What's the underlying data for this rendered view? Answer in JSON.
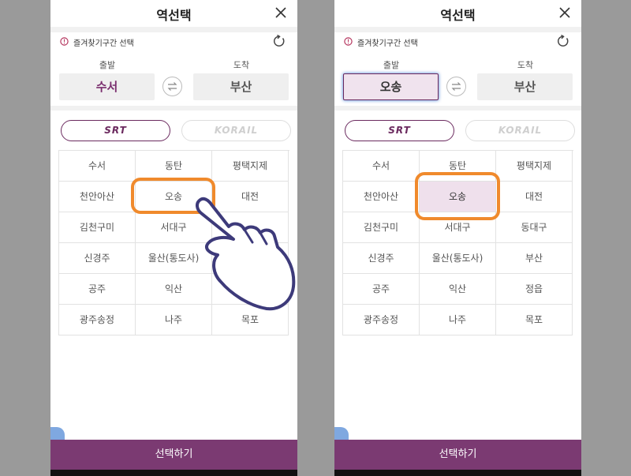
{
  "title": "역선택",
  "favorites_label": "즐겨찾기구간 선택",
  "direction": {
    "departure_label": "출발",
    "arrival_label": "도착"
  },
  "left": {
    "departure": "수서",
    "arrival": "부산"
  },
  "right": {
    "departure": "오송",
    "arrival": "부산"
  },
  "companies": {
    "srt": "SRT",
    "korail": "KORAIL"
  },
  "left_stations": [
    "수서",
    "동탄",
    "평택지제",
    "천안아산",
    "오송",
    "대전",
    "김천구미",
    "서대구",
    "",
    "신경주",
    "울산(통도사)",
    "",
    "공주",
    "익산",
    "",
    "광주송정",
    "나주",
    "목포"
  ],
  "right_stations": [
    "수서",
    "동탄",
    "평택지제",
    "천안아산",
    "오송",
    "대전",
    "김천구미",
    "서대구",
    "동대구",
    "신경주",
    "울산(통도사)",
    "부산",
    "공주",
    "익산",
    "정읍",
    "광주송정",
    "나주",
    "목포"
  ],
  "select_button": "선택하기",
  "colors": {
    "brand": "#7b3a72",
    "highlight": "#f08a2c",
    "selected_bg": "#efe0ec"
  },
  "icons": {
    "close": "close-icon",
    "refresh": "refresh-icon",
    "swap": "swap-icon",
    "info": "info-icon",
    "hand": "hand-pointer-icon"
  }
}
